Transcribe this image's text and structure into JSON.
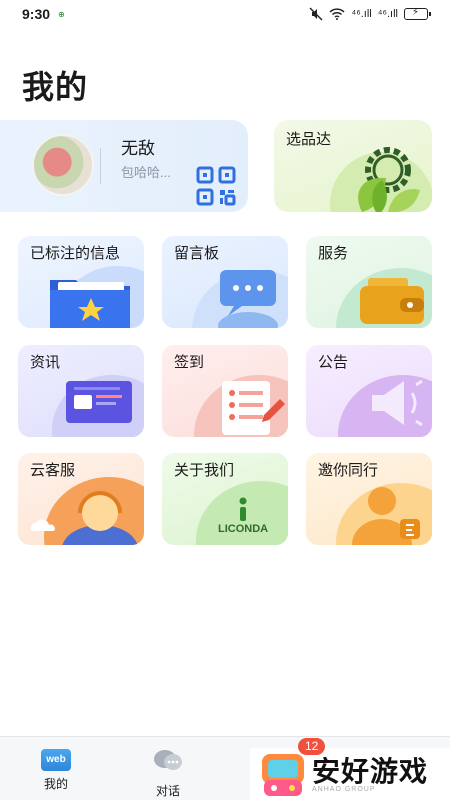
{
  "status_bar": {
    "time": "9:30",
    "small_icon": "⊕",
    "network_1": "⁴⁶.ıll",
    "network_2": "⁴⁶.ıll"
  },
  "page": {
    "title": "我的"
  },
  "profile": {
    "name": "无敌",
    "subtitle": "包哈哈..."
  },
  "cards": [
    {
      "label": "选品达"
    },
    {
      "label": "已标注的信息"
    },
    {
      "label": "留言板"
    },
    {
      "label": "服务"
    },
    {
      "label": "资讯"
    },
    {
      "label": "签到"
    },
    {
      "label": "公告"
    },
    {
      "label": "云客服"
    },
    {
      "label": "关于我们",
      "logo_text": "LICONDA"
    },
    {
      "label": "邀你同行"
    }
  ],
  "bottom_nav": {
    "items": [
      {
        "label": "我的",
        "icon_text": "web"
      },
      {
        "label": "对话"
      }
    ],
    "badge": "12"
  },
  "watermark": {
    "text": "安好游戏",
    "sub": "ANHAO GROUP"
  },
  "colors": {
    "accent_blue": "#2f6fe0",
    "badge_red": "#f0503c"
  }
}
